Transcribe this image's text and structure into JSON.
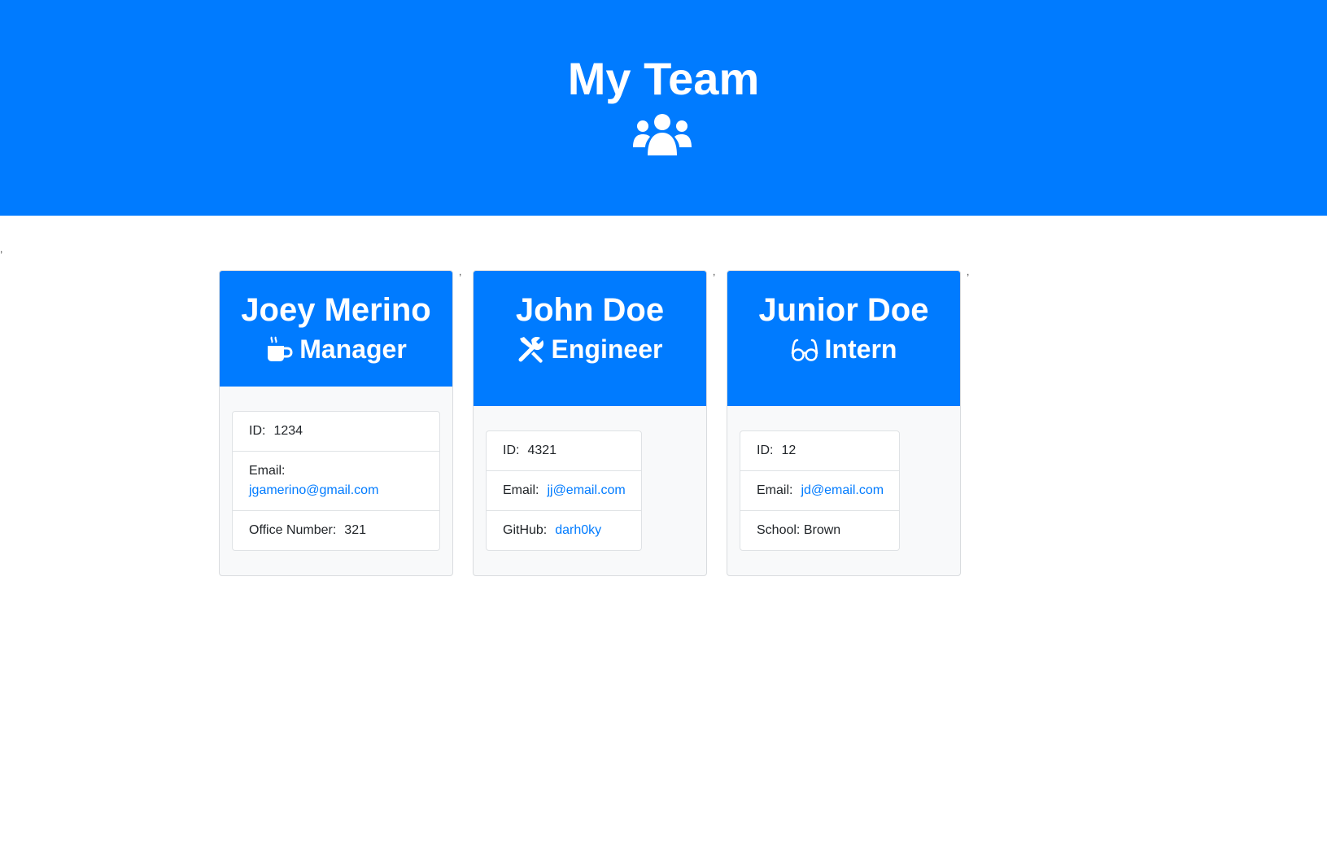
{
  "header": {
    "title": "My Team",
    "icon": "users-icon"
  },
  "colors": {
    "primary": "#007bff",
    "card_bg": "#f8f9fa",
    "link": "#007bff"
  },
  "stray_marks": [
    ",",
    ",",
    ",",
    ","
  ],
  "cards": [
    {
      "name": "Joey Merino",
      "role": "Manager",
      "role_icon": "coffee-mug-icon",
      "id_label": "ID:",
      "id_value": "1234",
      "email_label": "Email:",
      "email_value": "jgamerino@gmail.com",
      "extra_label": "Office Number:",
      "extra_value": "321"
    },
    {
      "name": "John Doe",
      "role": "Engineer",
      "role_icon": "tools-icon",
      "id_label": "ID:",
      "id_value": "4321",
      "email_label": "Email:",
      "email_value": "jj@email.com",
      "extra_label": "GitHub:",
      "extra_value": "darh0ky"
    },
    {
      "name": "Junior Doe",
      "role": "Intern",
      "role_icon": "glasses-icon",
      "id_label": "ID:",
      "id_value": "12",
      "email_label": "Email:",
      "email_value": "jd@email.com",
      "extra_label": "School:",
      "extra_value": "Brown"
    }
  ]
}
